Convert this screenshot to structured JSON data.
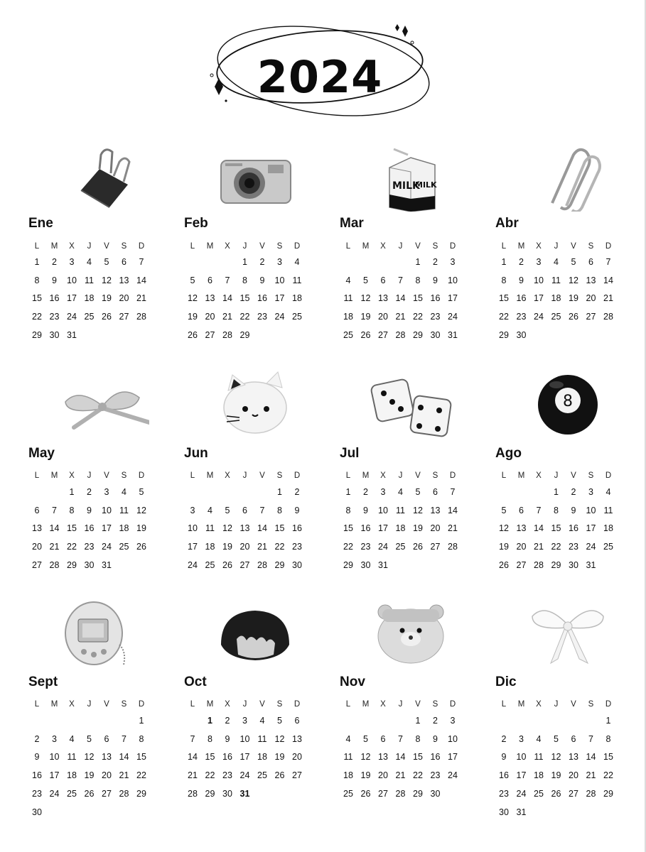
{
  "title": {
    "year": "2024"
  },
  "weekday_labels": [
    "L",
    "M",
    "X",
    "J",
    "V",
    "S",
    "D"
  ],
  "highlight_color": "#c27cf0",
  "months": [
    {
      "name": "Ene",
      "icon": "binder-clip-icon",
      "weeks": [
        [
          "1",
          "2",
          "3",
          "4",
          "5",
          "6",
          "7"
        ],
        [
          "8",
          "9",
          "10",
          "11",
          "12",
          "13",
          "14"
        ],
        [
          "15",
          "16",
          "17",
          "18",
          "19",
          "20",
          "21"
        ],
        [
          "22",
          "23",
          "24",
          "25",
          "26",
          "27",
          "28"
        ],
        [
          "29",
          "30",
          "31",
          "",
          "",
          "",
          ""
        ]
      ]
    },
    {
      "name": "Feb",
      "icon": "camera-icon",
      "weeks": [
        [
          "",
          "",
          "",
          "1",
          "2",
          "3",
          "4"
        ],
        [
          "5",
          "6",
          "7",
          "8",
          "9",
          "10",
          "11"
        ],
        [
          "12",
          "13",
          "14",
          "15",
          "16",
          "17",
          "18"
        ],
        [
          "19",
          "20",
          "21",
          "22",
          "23",
          "24",
          "25"
        ],
        [
          "26",
          "27",
          "28",
          "29",
          "",
          "",
          ""
        ]
      ]
    },
    {
      "name": "Mar",
      "icon": "milk-carton-icon",
      "weeks": [
        [
          "",
          "",
          "",
          "",
          "1",
          "2",
          "3"
        ],
        [
          "4",
          "5",
          "6",
          "7",
          "8",
          "9",
          "10"
        ],
        [
          "11",
          "12",
          "13",
          "14",
          "15",
          "16",
          "17"
        ],
        [
          "18",
          "19",
          "20",
          "21",
          "22",
          "23",
          "24"
        ],
        [
          "25",
          "26",
          "27",
          "28",
          "29",
          "30",
          "31"
        ]
      ]
    },
    {
      "name": "Abr",
      "icon": "paperclip-icon",
      "weeks": [
        [
          "1",
          "2",
          "3",
          "4",
          "5",
          "6",
          "7"
        ],
        [
          "8",
          "9",
          "10",
          "11",
          "12",
          "13",
          "14"
        ],
        [
          "15",
          "16",
          "17",
          "18",
          "19",
          "20",
          "21"
        ],
        [
          "22",
          "23",
          "24",
          "25",
          "26",
          "27",
          "28"
        ],
        [
          "29",
          "30",
          "",
          "",
          "",
          "",
          ""
        ]
      ]
    },
    {
      "name": "May",
      "icon": "ribbon-bow-icon",
      "weeks": [
        [
          "",
          "",
          "1",
          "2",
          "3",
          "4",
          "5"
        ],
        [
          "6",
          "7",
          "8",
          "9",
          "10",
          "11",
          "12"
        ],
        [
          "13",
          "14",
          "15",
          "16",
          "17",
          "18",
          "19"
        ],
        [
          "20",
          "21",
          "22",
          "23",
          "24",
          "25",
          "26"
        ],
        [
          "27",
          "28",
          "29",
          "30",
          "31",
          "",
          ""
        ]
      ]
    },
    {
      "name": "Jun",
      "icon": "cat-plush-icon",
      "weeks": [
        [
          "",
          "",
          "",
          "",
          "",
          "1",
          "2"
        ],
        [
          "3",
          "4",
          "5",
          "6",
          "7",
          "8",
          "9"
        ],
        [
          "10",
          "11",
          "12",
          "13",
          "14",
          "15",
          "16"
        ],
        [
          "17",
          "18",
          "19",
          "20",
          "21",
          "22",
          "23"
        ],
        [
          "24",
          "25",
          "26",
          "27",
          "28",
          "29",
          "30"
        ]
      ]
    },
    {
      "name": "Jul",
      "icon": "dice-icon",
      "weeks": [
        [
          "1",
          "2",
          "3",
          "4",
          "5",
          "6",
          "7"
        ],
        [
          "8",
          "9",
          "10",
          "11",
          "12",
          "13",
          "14"
        ],
        [
          "15",
          "16",
          "17",
          "18",
          "19",
          "20",
          "21"
        ],
        [
          "22",
          "23",
          "24",
          "25",
          "26",
          "27",
          "28"
        ],
        [
          "29",
          "30",
          "31",
          "",
          "",
          "",
          ""
        ]
      ]
    },
    {
      "name": "Ago",
      "icon": "eight-ball-icon",
      "weeks": [
        [
          "",
          "",
          "",
          "1",
          "2",
          "3",
          "4"
        ],
        [
          "5",
          "6",
          "7",
          "8",
          "9",
          "10",
          "11"
        ],
        [
          "12",
          "13",
          "14",
          "15",
          "16",
          "17",
          "18"
        ],
        [
          "19",
          "20",
          "21",
          "22",
          "23",
          "24",
          "25"
        ],
        [
          "26",
          "27",
          "28",
          "29",
          "30",
          "31",
          ""
        ]
      ]
    },
    {
      "name": "Sept",
      "icon": "tamagotchi-icon",
      "weeks": [
        [
          "",
          "",
          "",
          "",
          "",
          "",
          "1"
        ],
        [
          "2",
          "3",
          "4",
          "5",
          "6",
          "7",
          "8"
        ],
        [
          "9",
          "10",
          "11",
          "12",
          "13",
          "14",
          "15"
        ],
        [
          "16",
          "17",
          "18",
          "19",
          "20",
          "21",
          "22"
        ],
        [
          "23",
          "24",
          "25",
          "26",
          "27",
          "28",
          "29"
        ],
        [
          "30",
          "",
          "",
          "",
          "",
          "",
          ""
        ]
      ]
    },
    {
      "name": "Oct",
      "icon": "mochi-icon",
      "highlighted": [
        "1",
        "31"
      ],
      "weeks": [
        [
          "",
          "1",
          "2",
          "3",
          "4",
          "5",
          "6"
        ],
        [
          "7",
          "8",
          "9",
          "10",
          "11",
          "12",
          "13"
        ],
        [
          "14",
          "15",
          "16",
          "17",
          "18",
          "19",
          "20"
        ],
        [
          "21",
          "22",
          "23",
          "24",
          "25",
          "26",
          "27"
        ],
        [
          "28",
          "29",
          "30",
          "31",
          "",
          "",
          ""
        ]
      ]
    },
    {
      "name": "Nov",
      "icon": "bear-plush-icon",
      "weeks": [
        [
          "",
          "",
          "",
          "",
          "1",
          "2",
          "3"
        ],
        [
          "4",
          "5",
          "6",
          "7",
          "8",
          "9",
          "10"
        ],
        [
          "11",
          "12",
          "13",
          "14",
          "15",
          "16",
          "17"
        ],
        [
          "18",
          "19",
          "20",
          "21",
          "22",
          "23",
          "24"
        ],
        [
          "25",
          "26",
          "27",
          "28",
          "29",
          "30",
          ""
        ]
      ]
    },
    {
      "name": "Dic",
      "icon": "white-bow-icon",
      "weeks": [
        [
          "",
          "",
          "",
          "",
          "",
          "",
          "1"
        ],
        [
          "2",
          "3",
          "4",
          "5",
          "6",
          "7",
          "8"
        ],
        [
          "9",
          "10",
          "11",
          "12",
          "13",
          "14",
          "15"
        ],
        [
          "16",
          "17",
          "18",
          "19",
          "20",
          "21",
          "22"
        ],
        [
          "23",
          "24",
          "25",
          "26",
          "27",
          "28",
          "29"
        ],
        [
          "30",
          "31",
          "",
          "",
          "",
          "",
          ""
        ]
      ]
    }
  ]
}
